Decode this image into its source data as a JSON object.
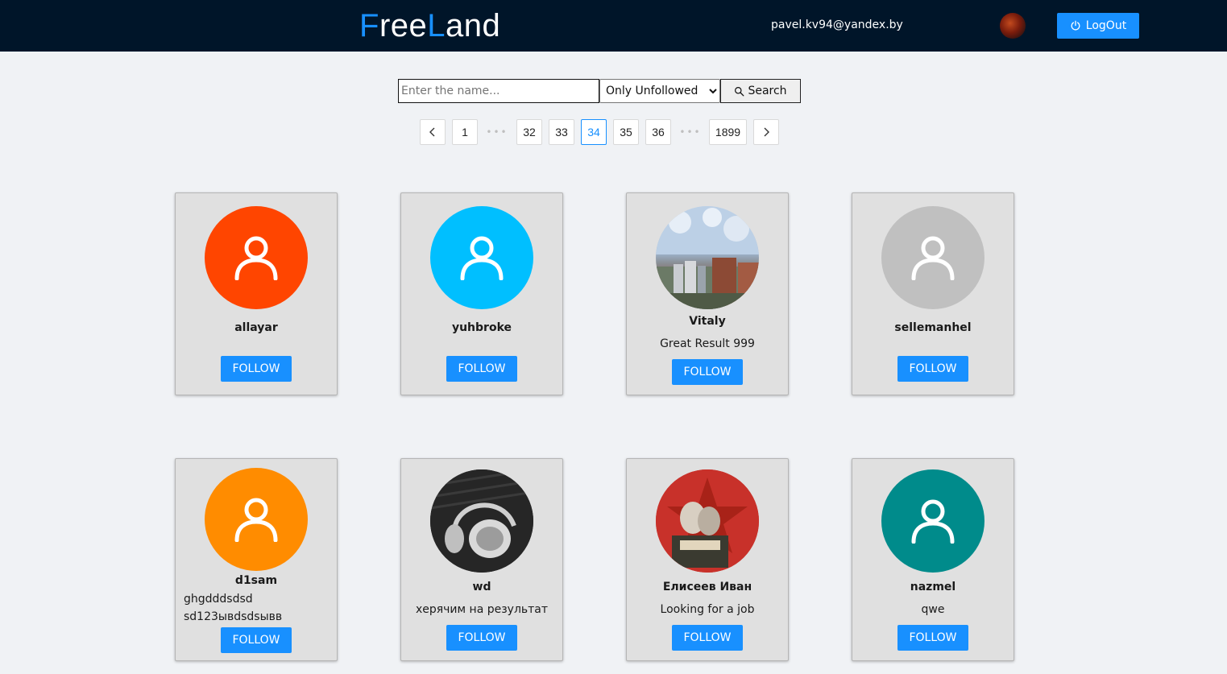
{
  "header": {
    "logo_first_letter": "F",
    "logo_part1": "ree",
    "logo_second_letter": "L",
    "logo_part2": "and",
    "email": "pavel.kv94@yandex.by",
    "logout_label": "LogOut",
    "logout_icon": "power-icon"
  },
  "search": {
    "placeholder": "Enter the name...",
    "filter_selected": "Only Unfollowed",
    "button_label": "Search",
    "button_icon": "search-icon"
  },
  "pagination": {
    "prev_icon": "chevron-left-icon",
    "next_icon": "chevron-right-icon",
    "pages": [
      "1",
      "32",
      "33",
      "34",
      "35",
      "36",
      "1899"
    ],
    "current": "34",
    "ellipsis": "•••"
  },
  "users": [
    {
      "name": "allayar",
      "status": "",
      "avatar": "default-user-icon",
      "avatar_color": "#ff4500",
      "follow_label": "FOLLOW"
    },
    {
      "name": "yuhbroke",
      "status": "",
      "avatar": "default-user-icon",
      "avatar_color": "#00bfff",
      "follow_label": "FOLLOW"
    },
    {
      "name": "Vitaly",
      "status": "Great Result 999",
      "avatar": "photo-city",
      "avatar_color": "#a9bfd6",
      "follow_label": "FOLLOW"
    },
    {
      "name": "sellemanhel",
      "status": "",
      "avatar": "default-user-icon",
      "avatar_color": "#c0c0c0",
      "follow_label": "FOLLOW"
    },
    {
      "name": "d1sam",
      "status_line1": "ghgdddsdsd",
      "status_line2": "sd123ывdsdsывв",
      "avatar": "default-user-icon",
      "avatar_color": "#ff8c00",
      "follow_label": "FOLLOW"
    },
    {
      "name": "wd",
      "status": "херячим на результат",
      "avatar": "photo-headphones",
      "avatar_color": "#2a2a2a",
      "follow_label": "FOLLOW"
    },
    {
      "name": "Елисеев Иван",
      "status": "Looking for a job",
      "avatar": "photo-poster",
      "avatar_color": "#c8312a",
      "follow_label": "FOLLOW"
    },
    {
      "name": "nazmel",
      "status": "qwe",
      "avatar": "default-user-icon",
      "avatar_color": "#008b8b",
      "follow_label": "FOLLOW"
    }
  ]
}
